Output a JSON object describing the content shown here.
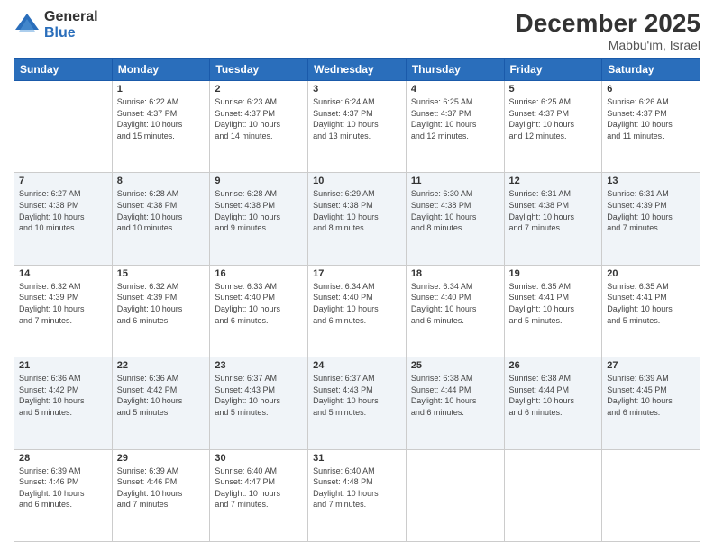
{
  "logo": {
    "general": "General",
    "blue": "Blue"
  },
  "header": {
    "title": "December 2025",
    "location": "Mabbu'im, Israel"
  },
  "columns": [
    "Sunday",
    "Monday",
    "Tuesday",
    "Wednesday",
    "Thursday",
    "Friday",
    "Saturday"
  ],
  "weeks": [
    [
      {
        "day": "",
        "info": ""
      },
      {
        "day": "1",
        "info": "Sunrise: 6:22 AM\nSunset: 4:37 PM\nDaylight: 10 hours\nand 15 minutes."
      },
      {
        "day": "2",
        "info": "Sunrise: 6:23 AM\nSunset: 4:37 PM\nDaylight: 10 hours\nand 14 minutes."
      },
      {
        "day": "3",
        "info": "Sunrise: 6:24 AM\nSunset: 4:37 PM\nDaylight: 10 hours\nand 13 minutes."
      },
      {
        "day": "4",
        "info": "Sunrise: 6:25 AM\nSunset: 4:37 PM\nDaylight: 10 hours\nand 12 minutes."
      },
      {
        "day": "5",
        "info": "Sunrise: 6:25 AM\nSunset: 4:37 PM\nDaylight: 10 hours\nand 12 minutes."
      },
      {
        "day": "6",
        "info": "Sunrise: 6:26 AM\nSunset: 4:37 PM\nDaylight: 10 hours\nand 11 minutes."
      }
    ],
    [
      {
        "day": "7",
        "info": "Sunrise: 6:27 AM\nSunset: 4:38 PM\nDaylight: 10 hours\nand 10 minutes."
      },
      {
        "day": "8",
        "info": "Sunrise: 6:28 AM\nSunset: 4:38 PM\nDaylight: 10 hours\nand 10 minutes."
      },
      {
        "day": "9",
        "info": "Sunrise: 6:28 AM\nSunset: 4:38 PM\nDaylight: 10 hours\nand 9 minutes."
      },
      {
        "day": "10",
        "info": "Sunrise: 6:29 AM\nSunset: 4:38 PM\nDaylight: 10 hours\nand 8 minutes."
      },
      {
        "day": "11",
        "info": "Sunrise: 6:30 AM\nSunset: 4:38 PM\nDaylight: 10 hours\nand 8 minutes."
      },
      {
        "day": "12",
        "info": "Sunrise: 6:31 AM\nSunset: 4:38 PM\nDaylight: 10 hours\nand 7 minutes."
      },
      {
        "day": "13",
        "info": "Sunrise: 6:31 AM\nSunset: 4:39 PM\nDaylight: 10 hours\nand 7 minutes."
      }
    ],
    [
      {
        "day": "14",
        "info": "Sunrise: 6:32 AM\nSunset: 4:39 PM\nDaylight: 10 hours\nand 7 minutes."
      },
      {
        "day": "15",
        "info": "Sunrise: 6:32 AM\nSunset: 4:39 PM\nDaylight: 10 hours\nand 6 minutes."
      },
      {
        "day": "16",
        "info": "Sunrise: 6:33 AM\nSunset: 4:40 PM\nDaylight: 10 hours\nand 6 minutes."
      },
      {
        "day": "17",
        "info": "Sunrise: 6:34 AM\nSunset: 4:40 PM\nDaylight: 10 hours\nand 6 minutes."
      },
      {
        "day": "18",
        "info": "Sunrise: 6:34 AM\nSunset: 4:40 PM\nDaylight: 10 hours\nand 6 minutes."
      },
      {
        "day": "19",
        "info": "Sunrise: 6:35 AM\nSunset: 4:41 PM\nDaylight: 10 hours\nand 5 minutes."
      },
      {
        "day": "20",
        "info": "Sunrise: 6:35 AM\nSunset: 4:41 PM\nDaylight: 10 hours\nand 5 minutes."
      }
    ],
    [
      {
        "day": "21",
        "info": "Sunrise: 6:36 AM\nSunset: 4:42 PM\nDaylight: 10 hours\nand 5 minutes."
      },
      {
        "day": "22",
        "info": "Sunrise: 6:36 AM\nSunset: 4:42 PM\nDaylight: 10 hours\nand 5 minutes."
      },
      {
        "day": "23",
        "info": "Sunrise: 6:37 AM\nSunset: 4:43 PM\nDaylight: 10 hours\nand 5 minutes."
      },
      {
        "day": "24",
        "info": "Sunrise: 6:37 AM\nSunset: 4:43 PM\nDaylight: 10 hours\nand 5 minutes."
      },
      {
        "day": "25",
        "info": "Sunrise: 6:38 AM\nSunset: 4:44 PM\nDaylight: 10 hours\nand 6 minutes."
      },
      {
        "day": "26",
        "info": "Sunrise: 6:38 AM\nSunset: 4:44 PM\nDaylight: 10 hours\nand 6 minutes."
      },
      {
        "day": "27",
        "info": "Sunrise: 6:39 AM\nSunset: 4:45 PM\nDaylight: 10 hours\nand 6 minutes."
      }
    ],
    [
      {
        "day": "28",
        "info": "Sunrise: 6:39 AM\nSunset: 4:46 PM\nDaylight: 10 hours\nand 6 minutes."
      },
      {
        "day": "29",
        "info": "Sunrise: 6:39 AM\nSunset: 4:46 PM\nDaylight: 10 hours\nand 7 minutes."
      },
      {
        "day": "30",
        "info": "Sunrise: 6:40 AM\nSunset: 4:47 PM\nDaylight: 10 hours\nand 7 minutes."
      },
      {
        "day": "31",
        "info": "Sunrise: 6:40 AM\nSunset: 4:48 PM\nDaylight: 10 hours\nand 7 minutes."
      },
      {
        "day": "",
        "info": ""
      },
      {
        "day": "",
        "info": ""
      },
      {
        "day": "",
        "info": ""
      }
    ]
  ]
}
